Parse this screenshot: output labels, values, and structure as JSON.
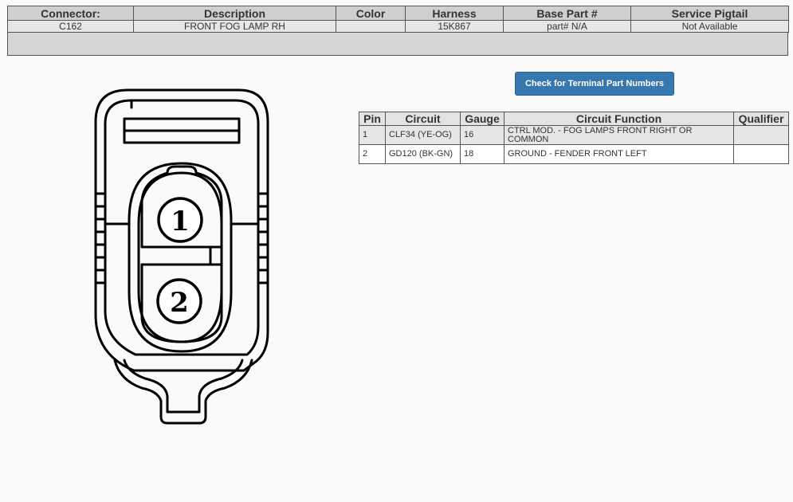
{
  "connector_info": {
    "headers": [
      "Connector:",
      "Description",
      "Color",
      "Harness",
      "Base Part #",
      "Service Pigtail"
    ],
    "values": [
      "C162",
      "FRONT FOG LAMP RH",
      "",
      "15K867",
      "part# N/A",
      "Not Available"
    ]
  },
  "terminal_button": {
    "label": "Check for Terminal Part Numbers"
  },
  "pin_table": {
    "headers": [
      "Pin",
      "Circuit",
      "Gauge",
      "Circuit Function",
      "Qualifier"
    ],
    "rows": [
      {
        "pin": "1",
        "circuit": "CLF34 (YE-OG)",
        "gauge": "16",
        "function": "CTRL MOD. - FOG LAMPS FRONT RIGHT OR COMMON",
        "qualifier": ""
      },
      {
        "pin": "2",
        "circuit": "GD120 (BK-GN)",
        "gauge": "18",
        "function": "GROUND - FENDER FRONT LEFT",
        "qualifier": ""
      }
    ]
  },
  "diagram": {
    "pin_labels": [
      "1",
      "2"
    ]
  }
}
